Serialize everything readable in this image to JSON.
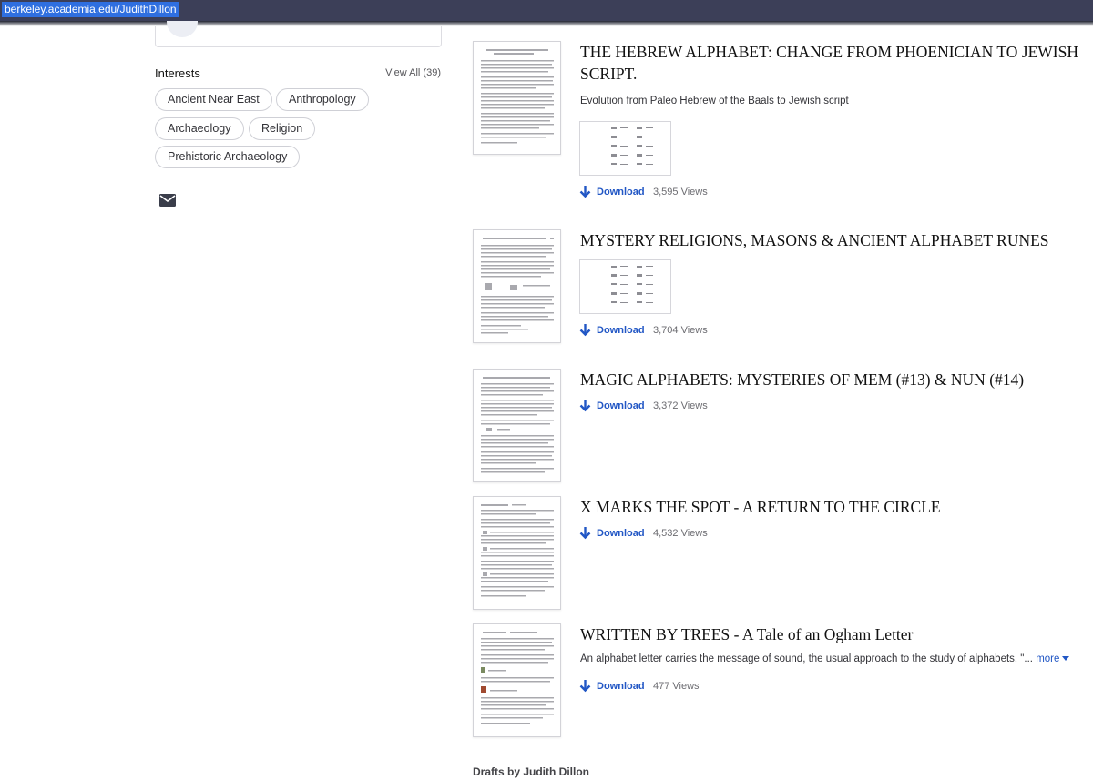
{
  "browser": {
    "url": "berkeley.academia.edu/JudithDillon"
  },
  "sidebar": {
    "interests_title": "Interests",
    "view_all": "View All (39)",
    "tags": [
      "Ancient Near East",
      "Anthropology",
      "Archaeology",
      "Religion",
      "Prehistoric Archaeology"
    ],
    "contact_icon": "mail-icon"
  },
  "works": [
    {
      "title": "THE HEBREW ALPHABET: CHANGE FROM PHOENICIAN TO JEWISH SCRIPT.",
      "description": "Evolution from Paleo Hebrew of the Baals to Jewish script",
      "download": "Download",
      "views": "3,595 Views"
    },
    {
      "title": "MYSTERY RELIGIONS, MASONS & ANCIENT ALPHABET RUNES",
      "download": "Download",
      "views": "3,704 Views"
    },
    {
      "title": "MAGIC ALPHABETS: MYSTERIES OF MEM (#13) & NUN (#14)",
      "download": "Download",
      "views": "3,372 Views"
    },
    {
      "title": "X MARKS THE SPOT - A RETURN TO THE CIRCLE",
      "download": "Download",
      "views": "4,532 Views"
    },
    {
      "title": "WRITTEN BY TREES - A Tale of an Ogham Letter",
      "description": "An alphabet letter carries the message of sound, the usual approach to the study of alphabets. \"...",
      "more": "more",
      "download": "Download",
      "views": "477 Views"
    }
  ],
  "drafts_heading": "Drafts by Judith Dillon",
  "colors": {
    "link": "#2257c5",
    "urlbar": "#3c3f58",
    "url_highlight": "#2f6fe0"
  }
}
